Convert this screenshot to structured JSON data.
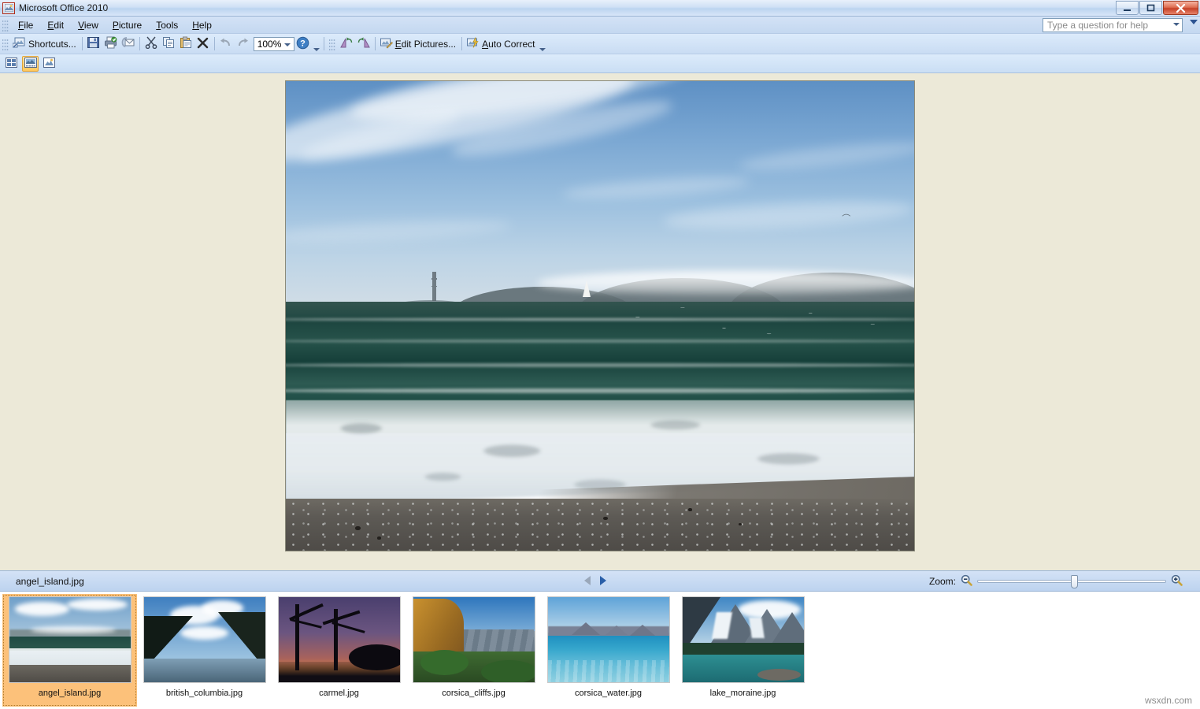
{
  "window": {
    "title": "Microsoft Office 2010",
    "icon": "picture-manager-icon",
    "minimize_label": "–",
    "maximize_label": "❐",
    "close_label": "✕"
  },
  "menubar": {
    "items": [
      {
        "label": "File",
        "accel": "F"
      },
      {
        "label": "Edit",
        "accel": "E"
      },
      {
        "label": "View",
        "accel": "V"
      },
      {
        "label": "Picture",
        "accel": "P"
      },
      {
        "label": "Tools",
        "accel": "T"
      },
      {
        "label": "Help",
        "accel": "H"
      }
    ],
    "help_search": {
      "placeholder": "Type a question for help",
      "value": ""
    }
  },
  "toolbar": {
    "shortcuts_label": "Shortcuts...",
    "zoom_value": "100%",
    "edit_pictures_label": "Edit Pictures...",
    "auto_correct_label": "Auto Correct",
    "buttons": [
      {
        "name": "shortcuts-button",
        "icon": "shortcuts-icon"
      },
      {
        "name": "save-button",
        "icon": "save-icon"
      },
      {
        "name": "print-button",
        "icon": "print-icon"
      },
      {
        "name": "email-button",
        "icon": "email-attachment-icon"
      },
      {
        "name": "cut-button",
        "icon": "scissors-icon"
      },
      {
        "name": "copy-button",
        "icon": "copy-icon"
      },
      {
        "name": "paste-button",
        "icon": "paste-icon"
      },
      {
        "name": "delete-button",
        "icon": "delete-x-icon"
      },
      {
        "name": "undo-button",
        "icon": "undo-arrow-icon"
      },
      {
        "name": "redo-button",
        "icon": "redo-arrow-icon"
      },
      {
        "name": "help-button",
        "icon": "help-question-icon"
      },
      {
        "name": "rotate-left-button",
        "icon": "rotate-left-icon"
      },
      {
        "name": "rotate-right-button",
        "icon": "rotate-right-icon"
      },
      {
        "name": "edit-pictures-button",
        "icon": "edit-pictures-icon"
      },
      {
        "name": "auto-correct-button",
        "icon": "auto-correct-icon"
      }
    ]
  },
  "viewbar": {
    "buttons": [
      {
        "name": "thumbnail-view-button",
        "icon": "thumbnail-grid-icon",
        "selected": false
      },
      {
        "name": "filmstrip-view-button",
        "icon": "filmstrip-icon",
        "selected": true
      },
      {
        "name": "single-picture-view-button",
        "icon": "single-picture-icon",
        "selected": false
      }
    ]
  },
  "preview": {
    "alt": "angel_island.jpg — ocean surf on beach with Golden Gate Bridge tower in fog and a sailboat"
  },
  "statusbar": {
    "filename": "angel_island.jpg",
    "prev_label": "◁",
    "next_label": "▷",
    "zoom_label": "Zoom:",
    "zoom_out_icon": "zoom-out-magnifier-icon",
    "zoom_in_icon": "zoom-in-magnifier-icon",
    "zoom_slider_value": 50
  },
  "filmstrip": {
    "items": [
      {
        "filename": "angel_island.jpg",
        "selected": true,
        "scene": "beach"
      },
      {
        "filename": "british_columbia.jpg",
        "selected": false,
        "scene": "fjord"
      },
      {
        "filename": "carmel.jpg",
        "selected": false,
        "scene": "sunset"
      },
      {
        "filename": "corsica_cliffs.jpg",
        "selected": false,
        "scene": "cliffs"
      },
      {
        "filename": "corsica_water.jpg",
        "selected": false,
        "scene": "water"
      },
      {
        "filename": "lake_moraine.jpg",
        "selected": false,
        "scene": "moraine"
      }
    ]
  },
  "watermark": {
    "text": "wsxdn.com"
  },
  "colors": {
    "titlebar": "#cfe0f5",
    "chrome": "#d3e2f6",
    "canvas": "#ece9d8",
    "selection": "#fcc17a",
    "accent": "#2a5fa8",
    "close_red": "#c64128"
  }
}
